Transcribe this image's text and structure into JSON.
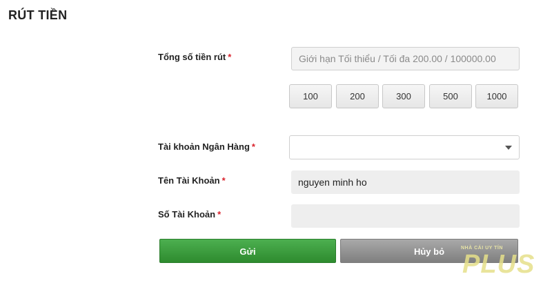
{
  "page": {
    "title": "RÚT TIỀN"
  },
  "form": {
    "amount": {
      "label": "Tổng số tiền rút",
      "required_mark": "*",
      "placeholder": "Giới hạn Tối thiểu / Tối đa 200.00 / 100000.00",
      "value": ""
    },
    "quick_amounts": [
      "100",
      "200",
      "300",
      "500",
      "1000"
    ],
    "bank_account": {
      "label": "Tài khoản Ngân Hàng",
      "required_mark": "*",
      "selected": ""
    },
    "account_name": {
      "label": "Tên Tài Khoản",
      "required_mark": "*",
      "value": "nguyen minh ho"
    },
    "account_number": {
      "label": "Số Tài Khoản",
      "required_mark": "*",
      "value": ""
    },
    "buttons": {
      "submit": "Gửi",
      "cancel": "Hủy bỏ"
    }
  },
  "watermark": {
    "tagline": "NHÀ CÁI UY TÍN",
    "logo": "PLUS"
  },
  "colors": {
    "required": "#d9232d",
    "submit": "#3f9e43",
    "cancel": "#8e8e8e"
  }
}
